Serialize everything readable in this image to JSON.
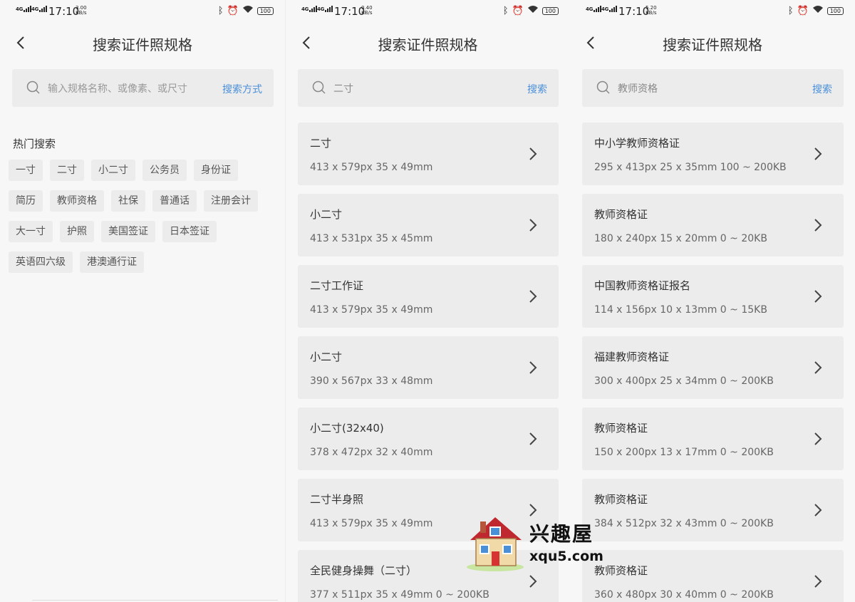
{
  "status_bars": [
    {
      "network": "4G",
      "network2": "4G",
      "time": "17:10",
      "speed": "3.00",
      "speed_unit": "KB/s",
      "battery": "100"
    },
    {
      "network": "4G",
      "network2": "4G",
      "time": "17:10",
      "speed": "0.40",
      "speed_unit": "KB/s",
      "battery": "100"
    },
    {
      "network": "4G",
      "network2": "4G",
      "time": "17:10",
      "speed": "5.20",
      "speed_unit": "KB/s",
      "battery": "100"
    }
  ],
  "screen1": {
    "title": "搜索证件照规格",
    "search": {
      "placeholder": "输入规格名称、或像素、或尺寸",
      "action": "搜索方式"
    },
    "hot_title": "热门搜索",
    "tags": [
      "一寸",
      "二寸",
      "小二寸",
      "公务员",
      "身份证",
      "简历",
      "教师资格",
      "社保",
      "普通话",
      "注册会计",
      "大一寸",
      "护照",
      "美国签证",
      "日本签证",
      "英语四六级",
      "港澳通行证"
    ]
  },
  "screen2": {
    "title": "搜索证件照规格",
    "search": {
      "value": "二寸",
      "action": "搜索"
    },
    "results": [
      {
        "name": "二寸",
        "spec": "413 x 579px 35 x 49mm"
      },
      {
        "name": "小二寸",
        "spec": "413 x 531px 35 x 45mm"
      },
      {
        "name": "二寸工作证",
        "spec": "413 x 579px 35 x 49mm"
      },
      {
        "name": "小二寸",
        "spec": "390 x 567px 33 x 48mm"
      },
      {
        "name": "小二寸(32x40)",
        "spec": "378 x 472px 32 x 40mm"
      },
      {
        "name": "二寸半身照",
        "spec": "413 x 579px 35 x 49mm"
      },
      {
        "name": "全民健身操舞（二寸）",
        "spec": "377 x 511px 35 x 49mm 0 ~ 200KB"
      }
    ]
  },
  "screen3": {
    "title": "搜索证件照规格",
    "search": {
      "value": "教师资格",
      "action": "搜索"
    },
    "results": [
      {
        "name": "中小学教师资格证",
        "spec": "295 x 413px 25 x 35mm 100 ~ 200KB"
      },
      {
        "name": "教师资格证",
        "spec": "180 x 240px 15 x 20mm 0 ~ 20KB"
      },
      {
        "name": "中国教师资格证报名",
        "spec": "114 x 156px 10 x 13mm 0 ~ 15KB"
      },
      {
        "name": "福建教师资格证",
        "spec": "300 x 400px 25 x 34mm 0 ~ 200KB"
      },
      {
        "name": "教师资格证",
        "spec": "150 x 200px 13 x 17mm 0 ~ 200KB"
      },
      {
        "name": "教师资格证",
        "spec": "384 x 512px 32 x 43mm 0 ~ 200KB"
      },
      {
        "name": "教师资格证",
        "spec": "360 x 480px 30 x 40mm 0 ~ 200KB"
      }
    ]
  },
  "watermark": {
    "title": "兴趣屋",
    "url": "xqu5.com"
  },
  "icons": {
    "back": "back-arrow-icon",
    "search": "search-icon",
    "chevron": "chevron-right-icon"
  },
  "colors": {
    "accent": "#4a90d9",
    "background": "#f7f7f7",
    "card": "#ececec"
  }
}
